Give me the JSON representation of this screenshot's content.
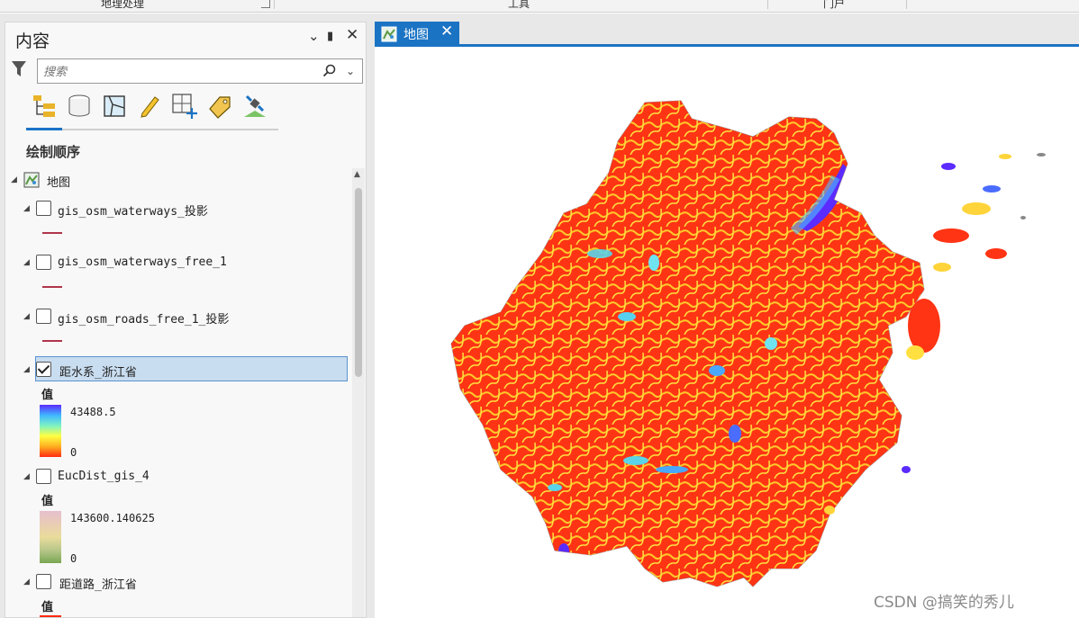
{
  "ribbon": {
    "groups": [
      "地理处理",
      "工具",
      "门户"
    ]
  },
  "contents_pane": {
    "title": "内容",
    "search_placeholder": "搜索",
    "section_title": "绘制顺序",
    "tool_icons": [
      "list-by-drawing-order-icon",
      "list-by-source-icon",
      "list-by-selection-icon",
      "list-by-editing-icon",
      "list-by-snapping-icon",
      "list-by-labeling-icon",
      "list-by-perspective-imagery-icon"
    ],
    "map_name": "地图",
    "layers": [
      {
        "name": "gis_osm_waterways_投影",
        "checked": false,
        "symbol": "line"
      },
      {
        "name": "gis_osm_waterways_free_1",
        "checked": false,
        "symbol": "line"
      },
      {
        "name": "gis_osm_roads_free_1_投影",
        "checked": false,
        "symbol": "line"
      },
      {
        "name": "距水系_浙江省",
        "checked": true,
        "selected": true,
        "legend_label": "值",
        "max": "43488.5",
        "min": "0",
        "ramp": [
          "#5b2bff",
          "#3fb6ff",
          "#7df2c4",
          "#ffff40",
          "#ffae20",
          "#ff2a10"
        ]
      },
      {
        "name": "EucDist_gis_4",
        "checked": false,
        "legend_label": "值",
        "max": "143600.140625",
        "min": "0",
        "ramp": [
          "#e7bfcf",
          "#e9cdb4",
          "#e9dc9c",
          "#b8c78a",
          "#7aa653"
        ]
      },
      {
        "name": "距道路_浙江省",
        "checked": false,
        "legend_label": "值"
      }
    ]
  },
  "map_tab": {
    "label": "地图"
  },
  "watermark": "CSDN @搞笑的秀儿"
}
